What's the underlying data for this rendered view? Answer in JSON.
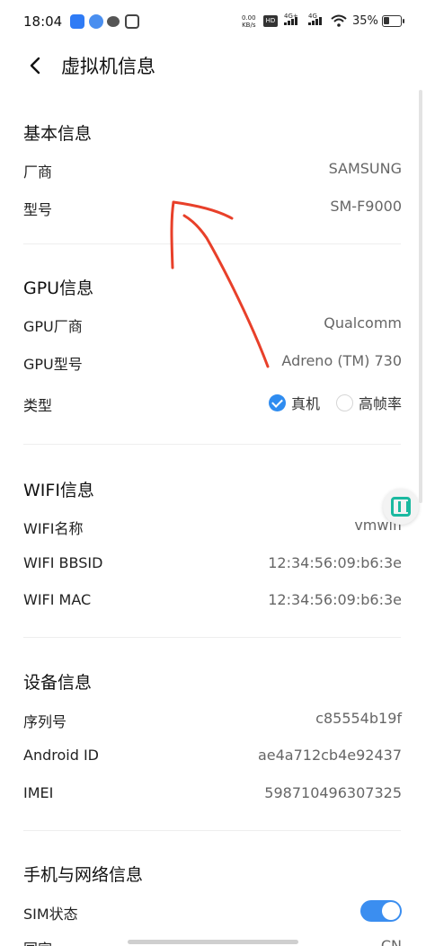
{
  "status_bar": {
    "time": "18:04",
    "speed_top": "0.00",
    "speed_unit": "KB/s",
    "hd": "HD",
    "sim1_net": "4G+",
    "sim2_net": "4G",
    "battery": "35%"
  },
  "header": {
    "title": "虚拟机信息"
  },
  "basic": {
    "title": "基本信息",
    "manufacturer_label": "厂商",
    "manufacturer_value": "SAMSUNG",
    "model_label": "型号",
    "model_value": "SM-F9000"
  },
  "gpu": {
    "title": "GPU信息",
    "vendor_label": "GPU厂商",
    "vendor_value": "Qualcomm",
    "model_label": "GPU型号",
    "model_value": "Adreno (TM) 730",
    "type_label": "类型",
    "type_options": [
      "真机",
      "高帧率"
    ],
    "type_selected": "真机"
  },
  "wifi": {
    "title": "WIFI信息",
    "name_label": "WIFI名称",
    "name_value": "vmwifi",
    "bssid_label": "WIFI BBSID",
    "bssid_value": "12:34:56:09:b6:3e",
    "mac_label": "WIFI MAC",
    "mac_value": "12:34:56:09:b6:3e"
  },
  "device": {
    "title": "设备信息",
    "serial_label": "序列号",
    "serial_value": "c85554b19f",
    "android_id_label": "Android ID",
    "android_id_value": "ae4a712cb4e92437",
    "imei_label": "IMEI",
    "imei_value": "598710496307325"
  },
  "network": {
    "title": "手机与网络信息",
    "sim_label": "SIM状态",
    "sim_enabled": true,
    "country_label": "国家",
    "country_value": "CN"
  },
  "colors": {
    "accent": "#2f8cf0",
    "annotation": "#e8402a",
    "widget": "#1bb9a0"
  }
}
